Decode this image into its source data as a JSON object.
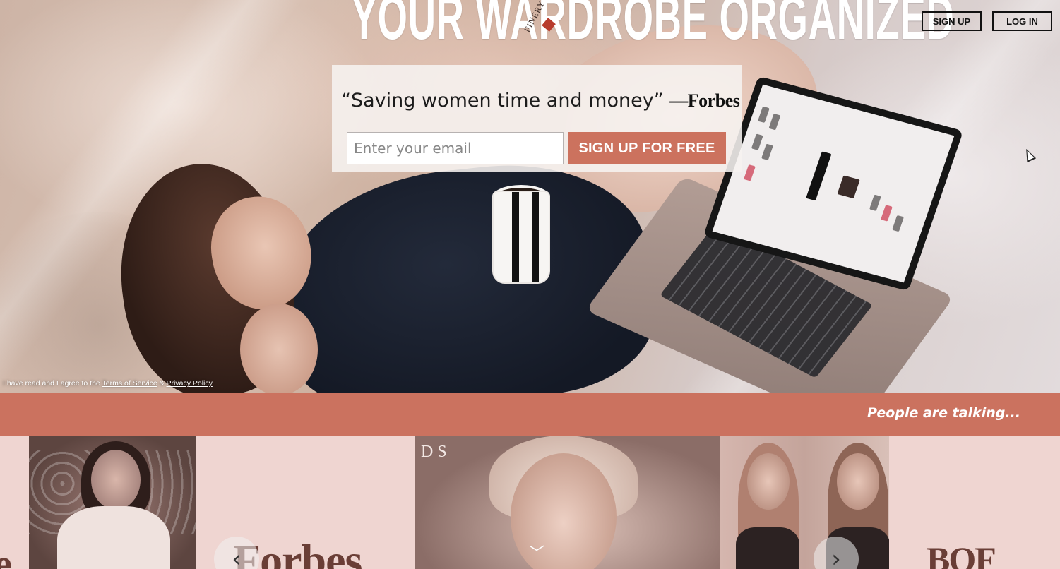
{
  "hero": {
    "headline": "YOUR WARDROBE ORGANIZED",
    "logo_text": "FINERY"
  },
  "nav": {
    "signup_label": "SIGN UP",
    "login_label": "LOG IN"
  },
  "signup_card": {
    "quote": "“Saving women time and money”",
    "quote_source": "—Forbes",
    "email_placeholder": "Enter your email",
    "email_value": "",
    "button_label": "SIGN UP FOR FREE"
  },
  "terms": {
    "prefix": "I have read and I agree to the ",
    "terms_link": "Terms of Service",
    "joiner": " & ",
    "privacy_link": "Privacy Policy"
  },
  "banner": {
    "text": "People are talking..."
  },
  "press": {
    "logos": {
      "left_partial": "e",
      "forbes": "Forbes",
      "bof": "BOF"
    },
    "photo_text": "DS"
  },
  "carousel": {
    "prev_icon": "‹",
    "next_icon": "›",
    "scroll_icon": "﹀"
  },
  "colors": {
    "accent": "#cc725e",
    "banner": "#cb725f",
    "press_background": "#efd5d1"
  }
}
